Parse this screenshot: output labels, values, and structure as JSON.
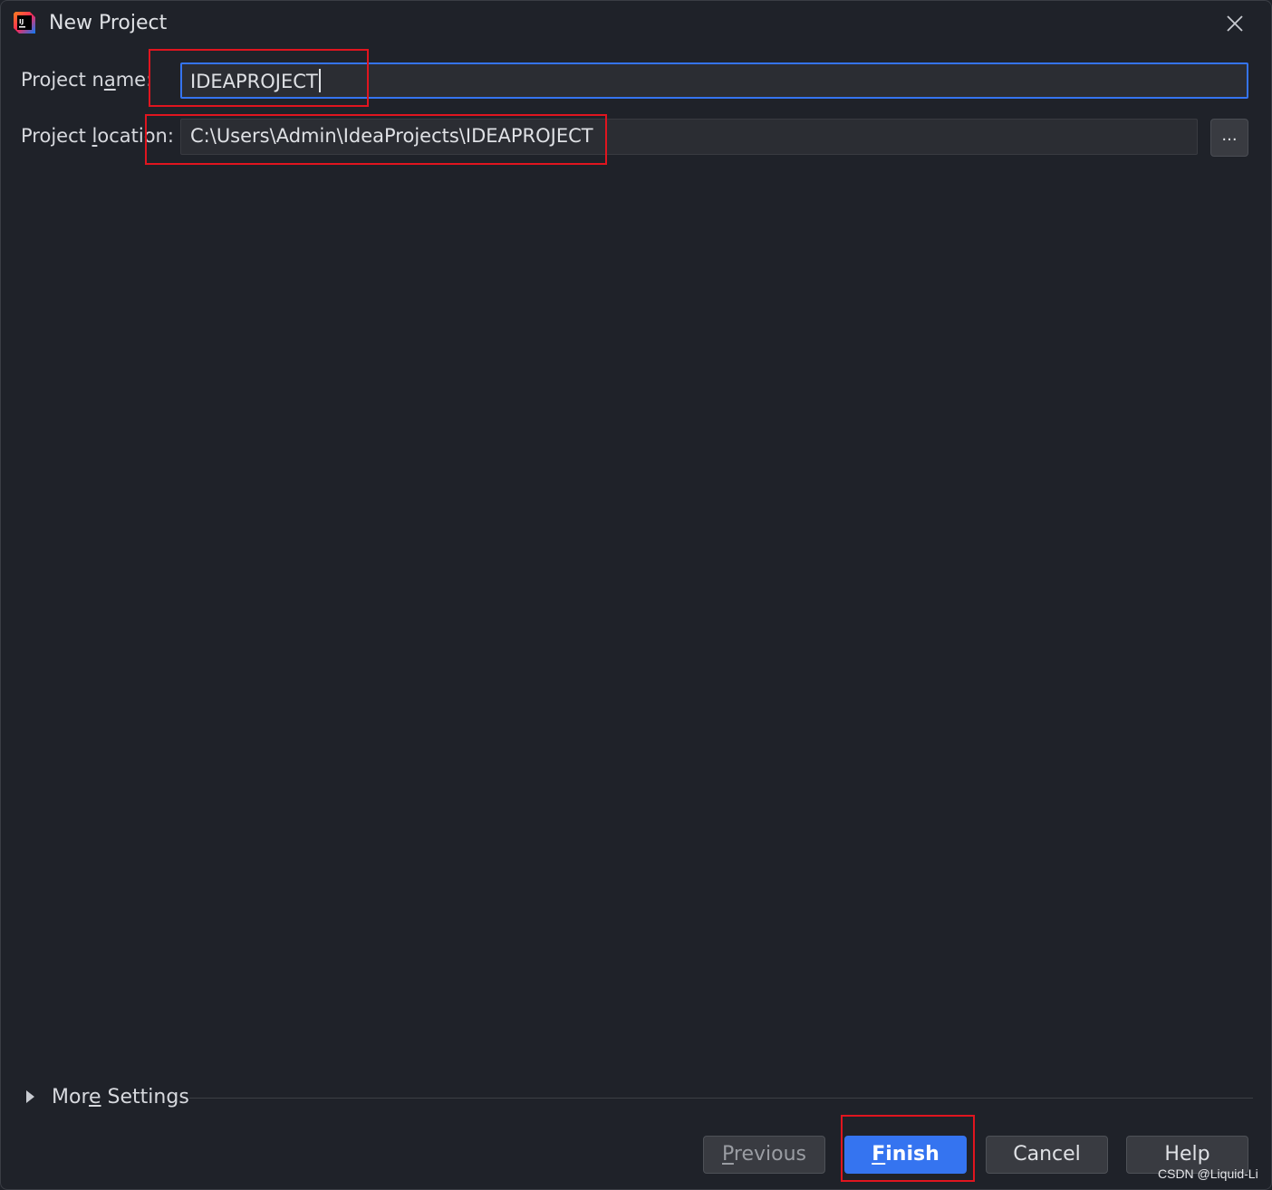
{
  "window": {
    "title": "New Project",
    "icon": "intellij-idea-icon",
    "close_icon": "close-icon"
  },
  "form": {
    "project_name": {
      "label_pre": "Project n",
      "label_mnemonic": "a",
      "label_post": "me:",
      "value": "IDEAPROJECT"
    },
    "project_location": {
      "label_pre": "Project ",
      "label_mnemonic": "l",
      "label_post": "ocation:",
      "value": "C:\\Users\\Admin\\IdeaProjects\\IDEAPROJECT",
      "browse_label": "..."
    }
  },
  "more_settings": {
    "label_pre": "Mor",
    "label_mnemonic": "e",
    "label_post": " Settings",
    "icon": "expand-triangle-icon"
  },
  "buttons": {
    "previous": {
      "mnemonic": "P",
      "rest": "revious",
      "disabled": true
    },
    "finish": {
      "mnemonic": "F",
      "rest": "inish"
    },
    "cancel": {
      "label": "Cancel"
    },
    "help": {
      "label": "Help"
    }
  },
  "colors": {
    "background": "#1f2229",
    "accent": "#3574f0",
    "highlight": "#e0151f"
  },
  "watermark": "CSDN @Liquid-Li"
}
